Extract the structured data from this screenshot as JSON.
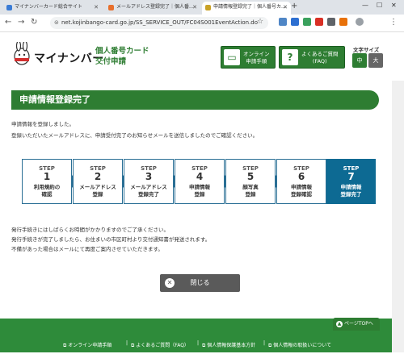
{
  "browser": {
    "tabs": [
      {
        "title": "マイナンバーカード総合サイト",
        "favicon_color": "#3a7bd5"
      },
      {
        "title": "メールアドレス登録完了｜個人番...",
        "favicon_color": "#e86f2c"
      },
      {
        "title": "申請情報登録完了｜個人番号カ...",
        "favicon_color": "#c9a227"
      }
    ],
    "url": "net.kojinbango-card.go.jp/SS_SERVICE_OUT/FC04S001EventAction.do"
  },
  "header": {
    "logo_text": "マイナンバー",
    "app_title_line1": "個人番号カード",
    "app_title_line2": "交付申請",
    "online_btn_line1": "オンライン",
    "online_btn_line2": "申請手順",
    "faq_btn_line1": "よくあるご質問",
    "faq_btn_line2": "(FAQ)",
    "fontsize_label": "文字サイズ",
    "fontsize_medium": "中",
    "fontsize_large": "大"
  },
  "main": {
    "title": "申請情報登録完了",
    "line1": "申請情報を登録しました。",
    "line2": "登録いただいたメールアドレスに、申請受付完了のお知らせメールを送信しましたのでご確認ください。",
    "steps": [
      {
        "label": "STEP",
        "num": "1",
        "line1": "利用規約の",
        "line2": "確認"
      },
      {
        "label": "STEP",
        "num": "2",
        "line1": "メールアドレス",
        "line2": "登録"
      },
      {
        "label": "STEP",
        "num": "3",
        "line1": "メールアドレス",
        "line2": "登録完了"
      },
      {
        "label": "STEP",
        "num": "4",
        "line1": "申請情報",
        "line2": "登録"
      },
      {
        "label": "STEP",
        "num": "5",
        "line1": "顔写真",
        "line2": "登録"
      },
      {
        "label": "STEP",
        "num": "6",
        "line1": "申請情報",
        "line2": "登録確認"
      },
      {
        "label": "STEP",
        "num": "7",
        "line1": "申請情報",
        "line2": "登録完了"
      }
    ],
    "current_step": 7,
    "note1": "発行手続きにはしばらくお時間がかかりますのでご了承ください。",
    "note2": "発行手続きが完了しましたら、お住まいの市区町村より交付通知書が発送されます。",
    "note3": "不備があった場合はメールにて再度ご案内させていただきます。",
    "close_label": "閉じる"
  },
  "footer": {
    "pagetop": "ページTOPへ",
    "links": [
      "オンライン申請手順",
      "よくあるご質問（FAQ）",
      "個人情報保護基本方針",
      "個人情報の取扱いについて"
    ]
  },
  "colors": {
    "brand_green": "#2e7d32",
    "step_active": "#0d6a93"
  }
}
